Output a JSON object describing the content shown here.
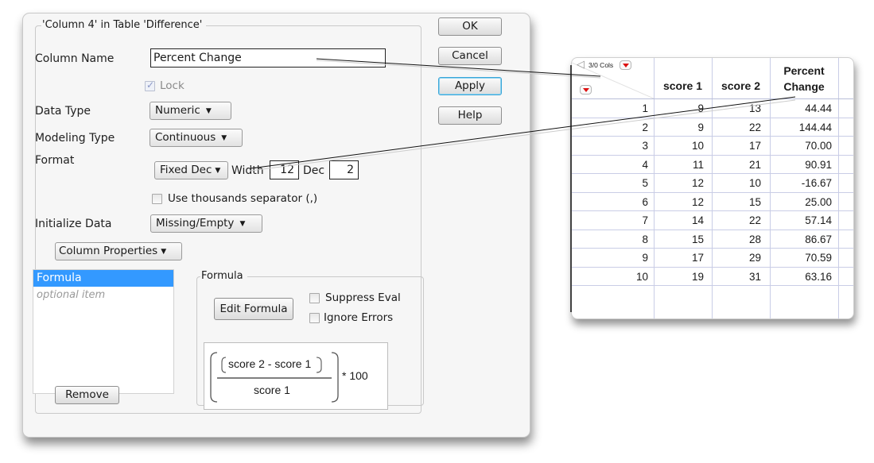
{
  "dialog": {
    "legend": "'Column 4' in Table 'Difference'",
    "column_name": {
      "label": "Column Name",
      "value": "Percent Change"
    },
    "lock": {
      "label": "Lock",
      "checked": true,
      "disabled": true
    },
    "data_type": {
      "label": "Data Type",
      "value": "Numeric"
    },
    "modeling_type": {
      "label": "Modeling Type",
      "value": "Continuous"
    },
    "format": {
      "label": "Format",
      "value": "Fixed Dec",
      "width_label": "Width",
      "width_value": "12",
      "dec_label": "Dec",
      "dec_value": "2"
    },
    "thousands": {
      "label": "Use thousands separator (,)",
      "checked": false
    },
    "initialize": {
      "label": "Initialize Data",
      "value": "Missing/Empty"
    },
    "column_properties": {
      "label": "Column Properties"
    },
    "properties_list": [
      {
        "label": "Formula",
        "selected": true
      },
      {
        "label": "optional item",
        "selected": false
      }
    ],
    "remove_label": "Remove",
    "formula_panel": {
      "legend": "Formula",
      "edit_label": "Edit Formula",
      "suppress_eval": {
        "label": "Suppress Eval",
        "checked": false
      },
      "ignore_errors": {
        "label": "Ignore Errors",
        "checked": false
      },
      "expression": {
        "numerator": "score 2 - score 1",
        "denominator": "score 1",
        "multiplier": "* 100"
      }
    },
    "buttons": {
      "ok": "OK",
      "cancel": "Cancel",
      "apply": "Apply",
      "help": "Help"
    }
  },
  "table": {
    "cols_indicator": "3/0 Cols",
    "columns": [
      "score 1",
      "score 2",
      "Percent",
      "Change"
    ],
    "rows": [
      [
        "1",
        "9",
        "13",
        "44.44"
      ],
      [
        "2",
        "9",
        "22",
        "144.44"
      ],
      [
        "3",
        "10",
        "17",
        "70.00"
      ],
      [
        "4",
        "11",
        "21",
        "90.91"
      ],
      [
        "5",
        "12",
        "10",
        "-16.67"
      ],
      [
        "6",
        "12",
        "15",
        "25.00"
      ],
      [
        "7",
        "14",
        "22",
        "57.14"
      ],
      [
        "8",
        "15",
        "28",
        "86.67"
      ],
      [
        "9",
        "17",
        "29",
        "70.59"
      ],
      [
        "10",
        "19",
        "31",
        "63.16"
      ]
    ]
  },
  "colors": {
    "selection": "#3399ff",
    "default_button_border": "#3aa6d8",
    "red_triangle": "#dd1111",
    "grid": "#c9cde6"
  }
}
